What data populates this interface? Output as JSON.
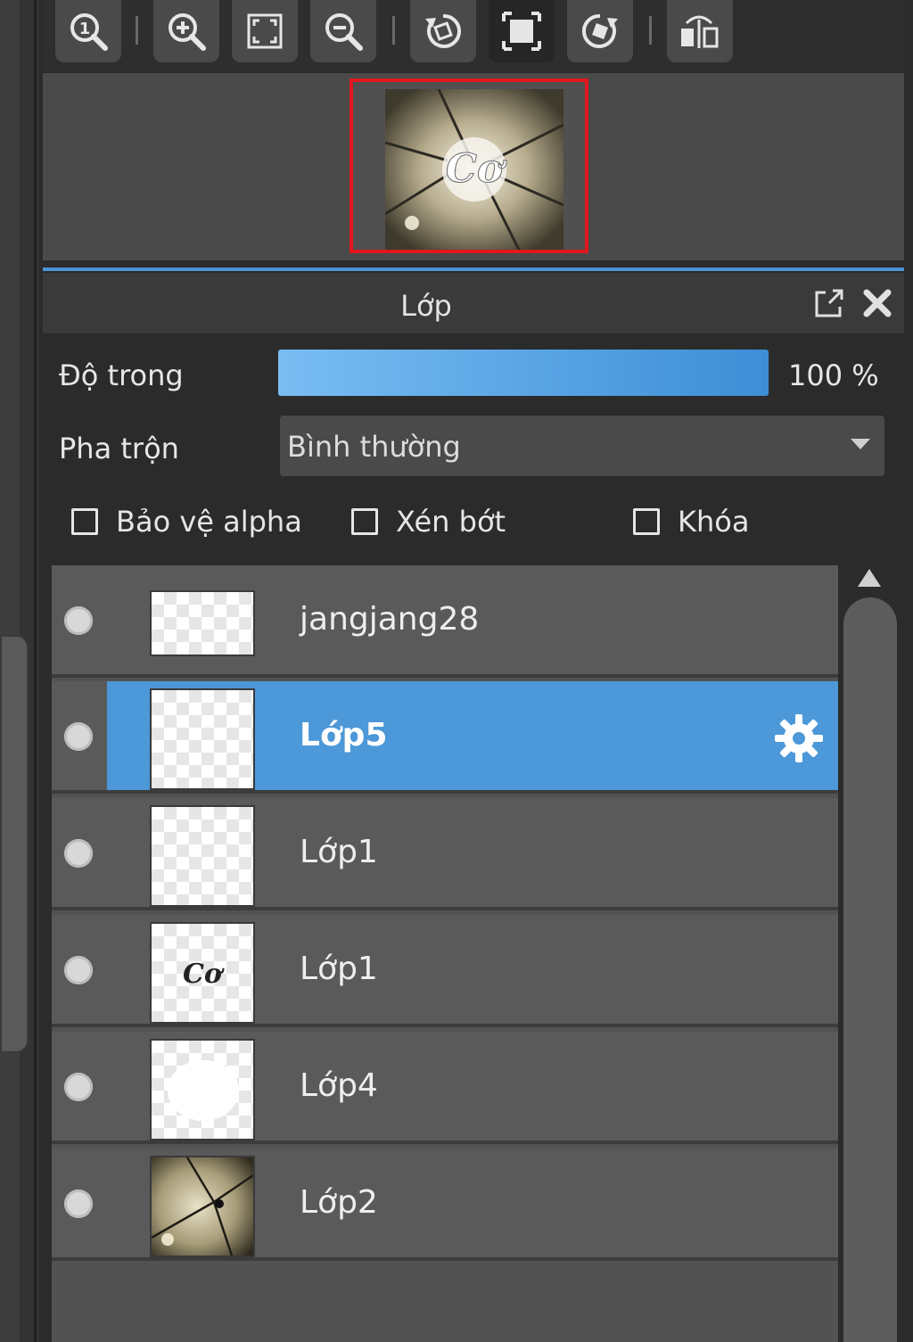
{
  "toolbar": {
    "buttons": [
      {
        "icon": "zoom-actual-icon"
      },
      {
        "icon": "zoom-in-icon"
      },
      {
        "icon": "fit-screen-icon"
      },
      {
        "icon": "zoom-out-icon"
      },
      {
        "icon": "rotate-left-icon"
      },
      {
        "icon": "crop-frame-icon"
      },
      {
        "icon": "rotate-right-icon"
      },
      {
        "icon": "flip-horizontal-icon"
      }
    ]
  },
  "panel": {
    "title": "Lớp",
    "icons": [
      "popout-icon",
      "close-icon"
    ],
    "accent_color": "#4a93d6",
    "selection_color": "#4c98d8"
  },
  "opacity": {
    "label": "Độ trong",
    "value": "100 %",
    "level": 1.0
  },
  "blend": {
    "label": "Pha trộn",
    "value": "Bình thường"
  },
  "options": {
    "protect_alpha": "Bảo vệ alpha",
    "clipping": "Xén bớt",
    "lock": "Khóa"
  },
  "layers": [
    {
      "name": "jangjang28",
      "selected": false,
      "thumb": "transparent"
    },
    {
      "name": "Lớp5",
      "selected": true,
      "thumb": "transparent"
    },
    {
      "name": "Lớp1",
      "selected": false,
      "thumb": "transparent"
    },
    {
      "name": "Lớp1",
      "selected": false,
      "thumb": "text"
    },
    {
      "name": "Lớp4",
      "selected": false,
      "thumb": "white-blob"
    },
    {
      "name": "Lớp2",
      "selected": false,
      "thumb": "photo"
    }
  ]
}
